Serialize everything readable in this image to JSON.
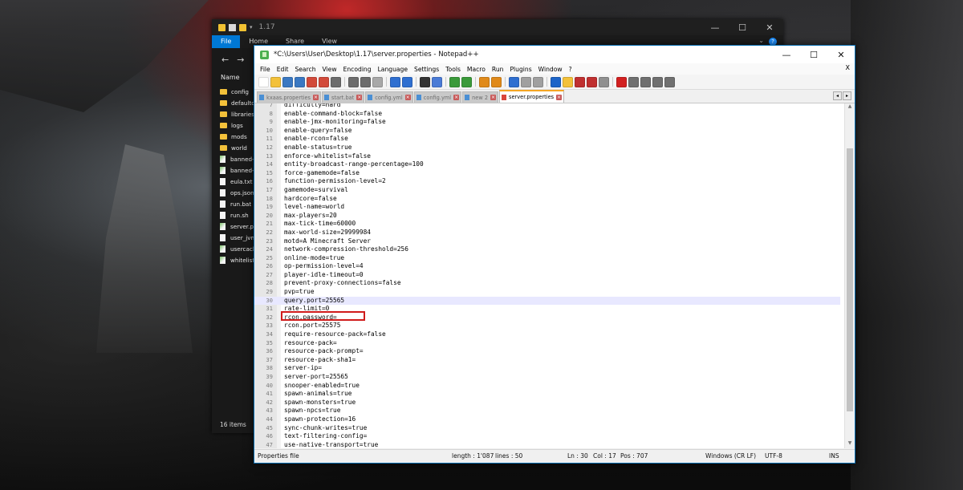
{
  "explorer": {
    "title_path": "1.17",
    "ribbon_tabs": [
      "File",
      "Home",
      "Share",
      "View"
    ],
    "column_name": "Name",
    "items": [
      {
        "name": "config",
        "type": "folder"
      },
      {
        "name": "defaultconfigs",
        "type": "folder"
      },
      {
        "name": "libraries",
        "type": "folder"
      },
      {
        "name": "logs",
        "type": "folder"
      },
      {
        "name": "mods",
        "type": "folder"
      },
      {
        "name": "world",
        "type": "folder"
      },
      {
        "name": "banned-ips.json",
        "type": "file-green"
      },
      {
        "name": "banned-players.json",
        "type": "file-green"
      },
      {
        "name": "eula.txt",
        "type": "file"
      },
      {
        "name": "ops.json",
        "type": "file"
      },
      {
        "name": "run.bat",
        "type": "file"
      },
      {
        "name": "run.sh",
        "type": "file"
      },
      {
        "name": "server.properties",
        "type": "file-green"
      },
      {
        "name": "user_jvm_args.txt",
        "type": "file"
      },
      {
        "name": "usercache.json",
        "type": "file-green"
      },
      {
        "name": "whitelist.json",
        "type": "file-green"
      }
    ],
    "item_count": "16 items"
  },
  "notepad": {
    "title": "*C:\\Users\\User\\Desktop\\1.17\\server.properties - Notepad++",
    "menu": [
      "File",
      "Edit",
      "Search",
      "View",
      "Encoding",
      "Language",
      "Settings",
      "Tools",
      "Macro",
      "Run",
      "Plugins",
      "Window",
      "?"
    ],
    "menu_close": "X",
    "tabs": [
      {
        "label": "kxaas.properties",
        "active": false
      },
      {
        "label": "start.bat",
        "active": false
      },
      {
        "label": "config.yml",
        "active": false
      },
      {
        "label": "config.yml",
        "active": false
      },
      {
        "label": "new 2",
        "active": false
      },
      {
        "label": "server.properties",
        "active": true
      }
    ],
    "lines": [
      {
        "n": "7",
        "text": "difficulty=hard"
      },
      {
        "n": "8",
        "text": "enable-command-block=false"
      },
      {
        "n": "9",
        "text": "enable-jmx-monitoring=false"
      },
      {
        "n": "10",
        "text": "enable-query=false"
      },
      {
        "n": "11",
        "text": "enable-rcon=false"
      },
      {
        "n": "12",
        "text": "enable-status=true"
      },
      {
        "n": "13",
        "text": "enforce-whitelist=false"
      },
      {
        "n": "14",
        "text": "entity-broadcast-range-percentage=100"
      },
      {
        "n": "15",
        "text": "force-gamemode=false"
      },
      {
        "n": "16",
        "text": "function-permission-level=2"
      },
      {
        "n": "17",
        "text": "gamemode=survival"
      },
      {
        "n": "18",
        "text": "hardcore=false"
      },
      {
        "n": "19",
        "text": "level-name=world"
      },
      {
        "n": "20",
        "text": "max-players=20"
      },
      {
        "n": "21",
        "text": "max-tick-time=60000"
      },
      {
        "n": "22",
        "text": "max-world-size=29999984"
      },
      {
        "n": "23",
        "text": "motd=A Minecraft Server"
      },
      {
        "n": "24",
        "text": "network-compression-threshold=256"
      },
      {
        "n": "25",
        "text": "online-mode=true"
      },
      {
        "n": "26",
        "text": "op-permission-level=4"
      },
      {
        "n": "27",
        "text": "player-idle-timeout=0"
      },
      {
        "n": "28",
        "text": "prevent-proxy-connections=false"
      },
      {
        "n": "29",
        "text": "pvp=true"
      },
      {
        "n": "30",
        "text": "query.port=25565"
      },
      {
        "n": "31",
        "text": "rate-limit=0"
      },
      {
        "n": "32",
        "text": "rcon.password="
      },
      {
        "n": "33",
        "text": "rcon.port=25575"
      },
      {
        "n": "34",
        "text": "require-resource-pack=false"
      },
      {
        "n": "35",
        "text": "resource-pack="
      },
      {
        "n": "36",
        "text": "resource-pack-prompt="
      },
      {
        "n": "37",
        "text": "resource-pack-sha1="
      },
      {
        "n": "38",
        "text": "server-ip="
      },
      {
        "n": "39",
        "text": "server-port=25565"
      },
      {
        "n": "40",
        "text": "snooper-enabled=true"
      },
      {
        "n": "41",
        "text": "spawn-animals=true"
      },
      {
        "n": "42",
        "text": "spawn-monsters=true"
      },
      {
        "n": "43",
        "text": "spawn-npcs=true"
      },
      {
        "n": "44",
        "text": "spawn-protection=16"
      },
      {
        "n": "45",
        "text": "sync-chunk-writes=true"
      },
      {
        "n": "46",
        "text": "text-filtering-config="
      },
      {
        "n": "47",
        "text": "use-native-transport=true"
      }
    ],
    "current_line": "30",
    "highlighted_line": "25",
    "status": {
      "file_type": "Properties file",
      "length": "length : 1'087",
      "lines": "lines : 50",
      "ln": "Ln : 30",
      "col": "Col : 17",
      "pos": "Pos : 707",
      "eol": "Windows (CR LF)",
      "encoding": "UTF-8",
      "ins": "INS"
    }
  }
}
